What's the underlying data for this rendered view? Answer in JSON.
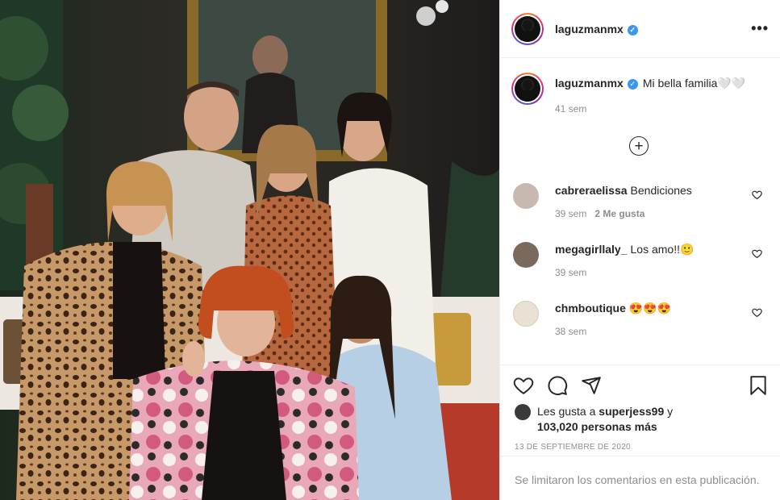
{
  "post": {
    "username": "laguzmanmx",
    "verified_glyph": "✓",
    "more_glyph": "•••",
    "caption": "Mi bella familia🤍🤍",
    "caption_time": "41 sem",
    "load_more_glyph": "+"
  },
  "comments": [
    {
      "user": "cabreraelissa",
      "text": "Bendiciones",
      "time": "39 sem",
      "likes": "2 Me gusta",
      "avatar_color": "#c8b9b0"
    },
    {
      "user": "megagirllaly_",
      "text": "Los amo!!🙂",
      "time": "39 sem",
      "likes": "",
      "avatar_color": "#7a6a5d"
    },
    {
      "user": "chmboutique",
      "text": "😍😍😍",
      "time": "38 sem",
      "likes": "",
      "avatar_color": "#e9e2d4"
    }
  ],
  "actions": {
    "like_icon": "heart-icon",
    "comment_icon": "comment-icon",
    "share_icon": "share-icon",
    "save_icon": "bookmark-icon"
  },
  "likes": {
    "prefix": "Les gusta a ",
    "user": "superjess99",
    "connector": " y ",
    "count": "103,020 personas más"
  },
  "date": "13 de septiembre de 2020",
  "limited_notice": "Se limitaron los comentarios en esta publicación.",
  "colors": {
    "verified": "#3897f0",
    "muted": "#8e8e8e",
    "text": "#262626",
    "divider": "#efefef"
  }
}
